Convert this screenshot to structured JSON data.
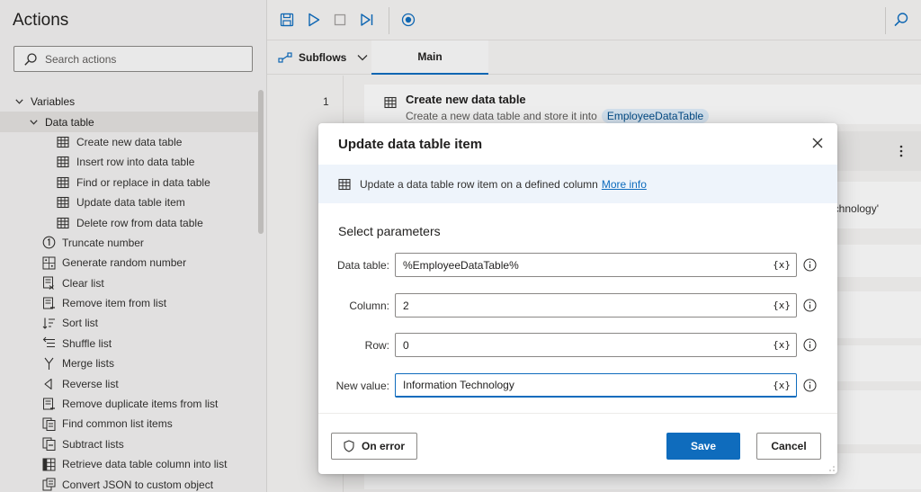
{
  "actions_pane": {
    "title": "Actions",
    "search_placeholder": "Search actions",
    "tree": [
      {
        "label": "Variables",
        "level": "lvl0",
        "kind": "group",
        "chevron": "down",
        "icon": ""
      },
      {
        "label": "Data table",
        "level": "lvl1",
        "kind": "group",
        "chevron": "down",
        "icon": "",
        "selected": true
      },
      {
        "label": "Create new data table",
        "level": "lvl2",
        "icon": "table-icon"
      },
      {
        "label": "Insert row into data table",
        "level": "lvl2",
        "icon": "table-icon"
      },
      {
        "label": "Find or replace in data table",
        "level": "lvl2",
        "icon": "table-icon"
      },
      {
        "label": "Update data table item",
        "level": "lvl2",
        "icon": "table-icon"
      },
      {
        "label": "Delete row from data table",
        "level": "lvl2",
        "icon": "table-icon"
      },
      {
        "label": "Truncate number",
        "level": "lvl1b",
        "icon": "number-one-icon"
      },
      {
        "label": "Generate random number",
        "level": "lvl1b",
        "icon": "random-number-icon"
      },
      {
        "label": "Clear list",
        "level": "lvl1b",
        "icon": "clear-list-icon"
      },
      {
        "label": "Remove item from list",
        "level": "lvl1b",
        "icon": "list-remove-icon"
      },
      {
        "label": "Sort list",
        "level": "lvl1b",
        "icon": "sort-icon"
      },
      {
        "label": "Shuffle list",
        "level": "lvl1b",
        "icon": "shuffle-icon"
      },
      {
        "label": "Merge lists",
        "level": "lvl1b",
        "icon": "merge-icon"
      },
      {
        "label": "Reverse list",
        "level": "lvl1b",
        "icon": "reverse-icon"
      },
      {
        "label": "Remove duplicate items from list",
        "level": "lvl1b",
        "icon": "list-remove-icon"
      },
      {
        "label": "Find common list items",
        "level": "lvl1b",
        "icon": "list-common-icon"
      },
      {
        "label": "Subtract lists",
        "level": "lvl1b",
        "icon": "subtract-list-icon"
      },
      {
        "label": "Retrieve data table column into list",
        "level": "lvl1b",
        "icon": "table-column-icon"
      },
      {
        "label": "Convert JSON to custom object",
        "level": "lvl1b",
        "icon": "json-icon"
      }
    ]
  },
  "tabs": {
    "subflows_label": "Subflows",
    "main_label": "Main"
  },
  "flow": {
    "line_number": "1",
    "first_action_title": "Create new data table",
    "first_action_desc": "Create a new data table and store it into",
    "first_action_var": "EmployeeDataTable",
    "partial_text": "chnology'"
  },
  "modal": {
    "title": "Update data table item",
    "info_text": "Update a data table row item on a defined column",
    "info_link": "More info",
    "section_heading": "Select parameters",
    "var_token": "{x}",
    "params": [
      {
        "label": "Data table:",
        "value": "%EmployeeDataTable%"
      },
      {
        "label": "Column:",
        "value": "2"
      },
      {
        "label": "Row:",
        "value": "0"
      },
      {
        "label": "New value:",
        "value": "Information Technology"
      }
    ],
    "on_error_label": "On error",
    "save_label": "Save",
    "cancel_label": "Cancel"
  },
  "colors": {
    "accent": "#0f6cbd",
    "pill_bg": "#deecf9",
    "info_band": "#eef4fb"
  }
}
